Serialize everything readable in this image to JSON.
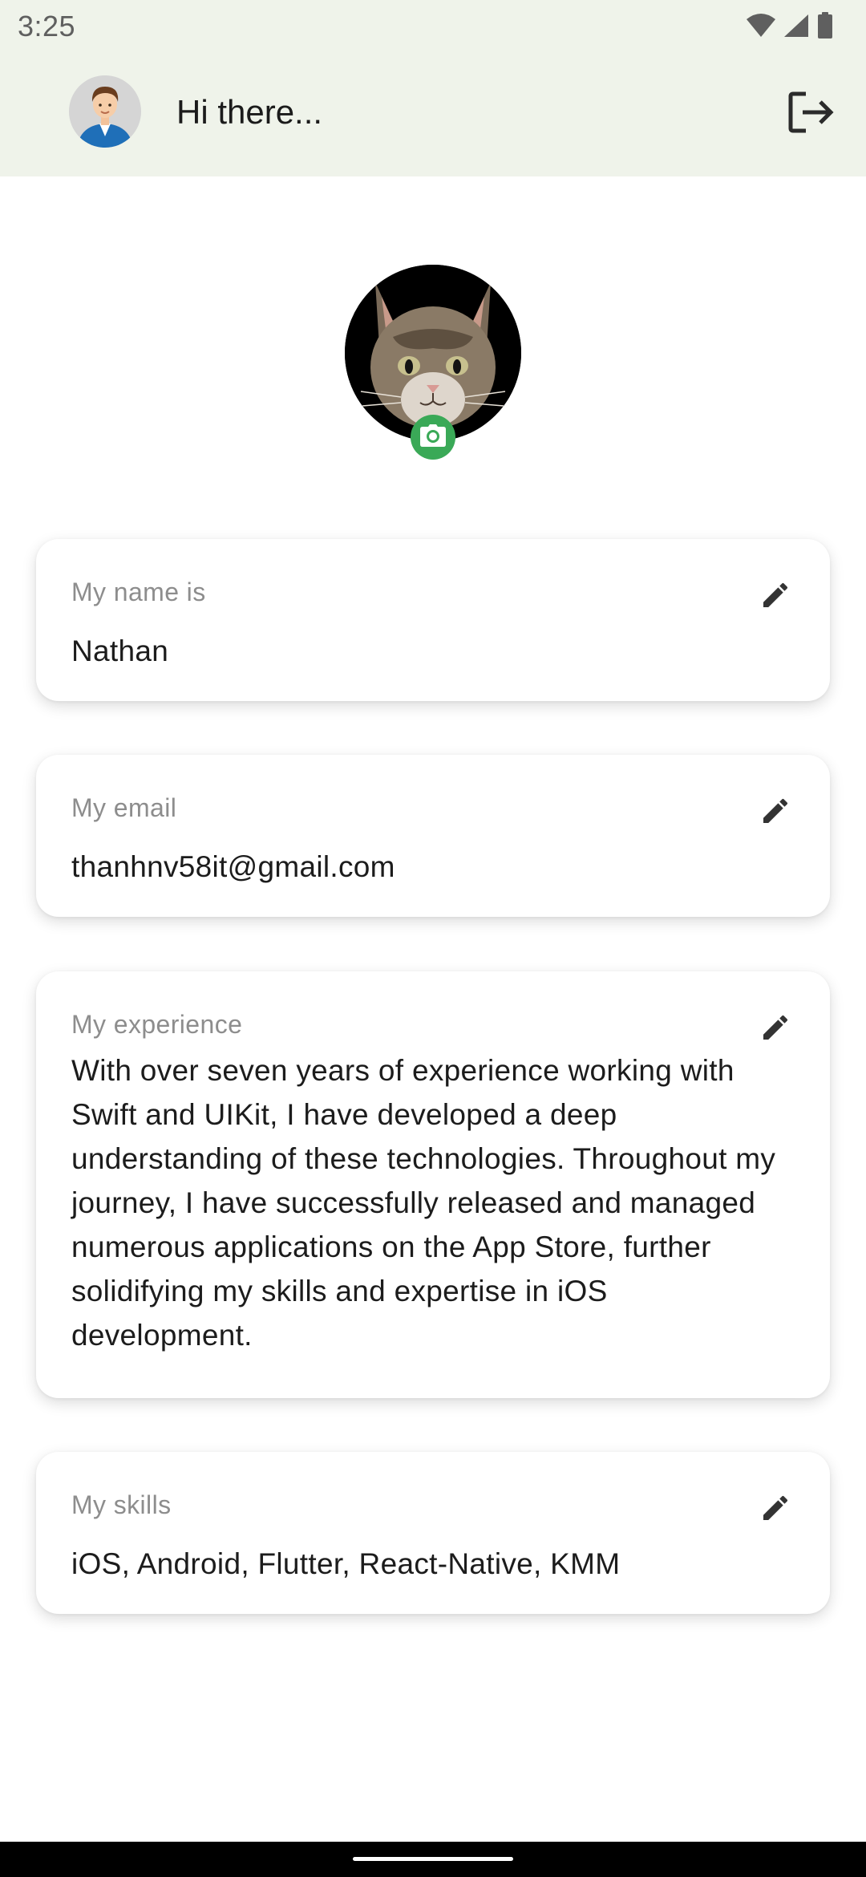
{
  "status_bar": {
    "time": "3:25",
    "icons": [
      "wifi-icon",
      "cellular-signal-icon",
      "battery-icon"
    ]
  },
  "app_bar": {
    "greeting": "Hi there...",
    "avatar_icon": "user-avatar",
    "logout_icon": "logout-icon"
  },
  "profile": {
    "photo": "cat-profile-photo",
    "camera_icon": "camera-icon",
    "badge_color": "#3aa957"
  },
  "cards": {
    "name": {
      "label": "My name is",
      "value": "Nathan",
      "edit_icon": "pencil-icon"
    },
    "email": {
      "label": "My email",
      "value": "thanhnv58it@gmail.com",
      "edit_icon": "pencil-icon"
    },
    "experience": {
      "label": "My experience",
      "value": "With over seven years of experience working with Swift and UIKit, I have developed a deep understanding of these technologies. Throughout my journey, I have successfully released and managed numerous applications on the App Store, further solidifying my skills and expertise in iOS development.",
      "edit_icon": "pencil-icon"
    },
    "skills": {
      "label": "My skills",
      "value": "iOS, Android, Flutter, React-Native, KMM",
      "edit_icon": "pencil-icon"
    }
  },
  "colors": {
    "app_bar_background": "#eff3ea",
    "card_background": "#ffffff",
    "label_text": "#8d8d8d",
    "value_text": "#1c1c1c"
  }
}
